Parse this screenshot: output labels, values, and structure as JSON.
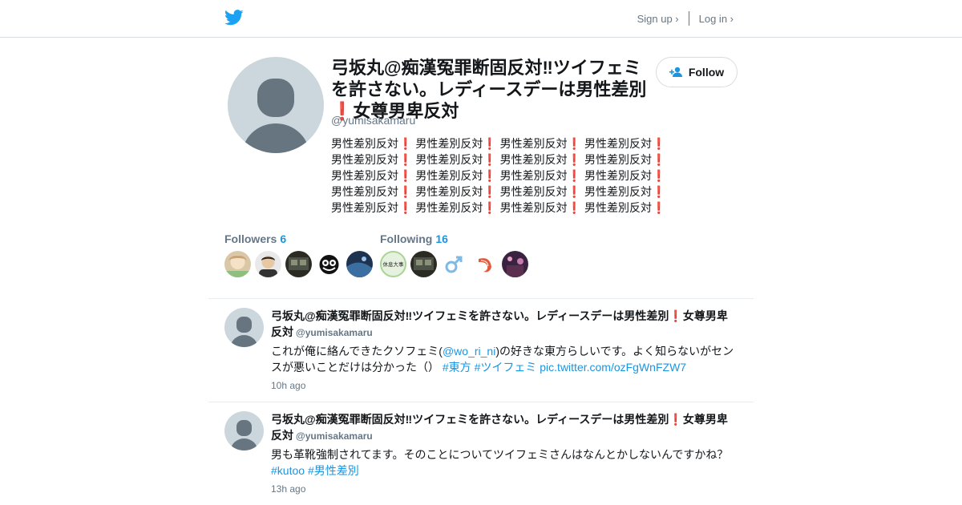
{
  "nav": {
    "signup": "Sign up ›",
    "login": "Log in ›"
  },
  "profile": {
    "name": "弓坂丸@痴漢冤罪断固反対‼ツイフェミを許さない。レディースデーは男性差別❗女尊男卑反対",
    "handle": "@yumisakamaru",
    "bio_lines": [
      "男性差別反対❗ 男性差別反対❗ 男性差別反対❗ 男性差別反対❗",
      "男性差別反対❗ 男性差別反対❗ 男性差別反対❗ 男性差別反対❗",
      "男性差別反対❗ 男性差別反対❗ 男性差別反対❗ 男性差別反対❗",
      "男性差別反対❗ 男性差別反対❗ 男性差別反対❗ 男性差別反対❗",
      "男性差別反対❗ 男性差別反対❗ 男性差別反対❗ 男性差別反対❗"
    ],
    "follow_label": "Follow"
  },
  "followers": {
    "label": "Followers",
    "count": "6"
  },
  "following": {
    "label": "Following",
    "count": "16"
  },
  "following_avatar_text": "休息大事",
  "tweets": [
    {
      "author": "弓坂丸@痴漢冤罪断固反対‼ツイフェミを許さない。レディースデーは男性差別❗女尊男卑反対",
      "handle": "@yumisakamaru",
      "text_before": "これが俺に絡んできたクソフェミ(",
      "mention": "@wo_ri_ni",
      "text_after": ")の好きな東方らしいです。よく知らないがセンスが悪いことだけは分かった（）",
      "tag1": "#東方",
      "tag2": "#ツイフェミ",
      "link": "pic.twitter.com/ozFgWnFZW7",
      "time": "10h ago"
    },
    {
      "author": "弓坂丸@痴漢冤罪断固反対‼ツイフェミを許さない。レディースデーは男性差別❗女尊男卑反対",
      "handle": "@yumisakamaru",
      "text": "男も革靴強制されてます。そのことについてツイフェミさんはなんとかしないんですかね？",
      "tag1": "#kutoo",
      "tag2": "#男性差別",
      "time": "13h ago"
    }
  ],
  "colors": {
    "accent": "#1b95e0",
    "twitter_blue": "#1da1f2",
    "muted": "#657786",
    "avatar_bg": "#ccd6dd",
    "avatar_fg": "#66757f"
  },
  "icons": [
    "twitter-bird-icon",
    "add-user-icon",
    "default-avatar-icon"
  ]
}
